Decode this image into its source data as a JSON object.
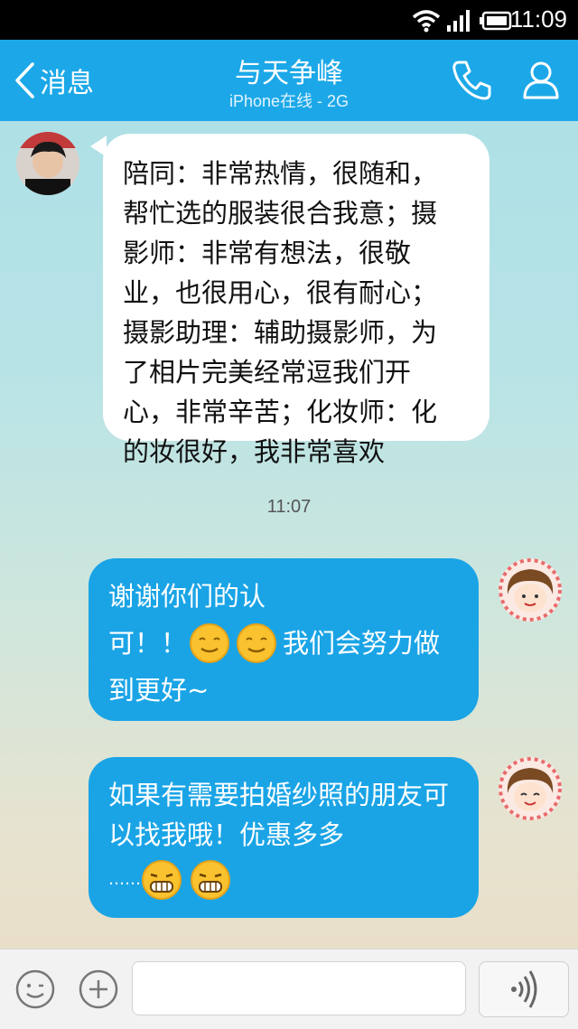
{
  "status_bar": {
    "time": "11:09"
  },
  "header": {
    "back_label": "消息",
    "contact_name": "与天争峰",
    "contact_status": "iPhone在线 - 2G"
  },
  "messages": [
    {
      "direction": "incoming",
      "text": "陪同：非常热情，很随和，帮忙选的服装很合我意；摄影师：非常有想法，很敬业，也很用心，很有耐心；摄影助理：辅助摄影师，为了相片完美经常逗我们开心，非常辛苦；化妆师：化的妆很好，我非常喜欢"
    },
    {
      "type": "timestamp",
      "text": "11:07"
    },
    {
      "direction": "outgoing",
      "line1": "谢谢你们的认",
      "line2_prefix": "可！！",
      "line2_suffix": "我们会努力做",
      "line3": "到更好~",
      "emojis": [
        "smile-emoji",
        "smile-emoji"
      ]
    },
    {
      "direction": "outgoing",
      "line1": "如果有需要拍婚纱照的朋友可",
      "line2": "以找我哦！优惠多多",
      "line3_prefix": "……",
      "emojis": [
        "grin-emoji",
        "grin-emoji"
      ]
    }
  ],
  "colors": {
    "header": "#1ca8e8",
    "outgoing_bubble": "#1aa4e6",
    "incoming_bubble": "#ffffff"
  },
  "icons": [
    "wifi-icon",
    "signal-icon",
    "battery-icon",
    "back-icon",
    "phone-icon",
    "profile-icon",
    "emoji-face-icon",
    "plus-icon",
    "voice-icon"
  ]
}
